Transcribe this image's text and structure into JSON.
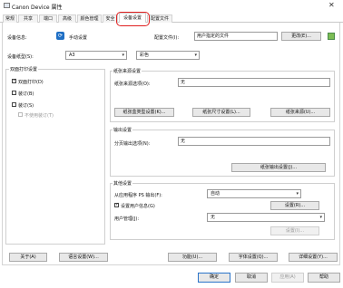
{
  "window": {
    "title": "Canon Device 属性",
    "close": "✕"
  },
  "tabs": [
    "常规",
    "共享",
    "端口",
    "高级",
    "颜色管理",
    "安全",
    "设备设置",
    "配置文件"
  ],
  "header": {
    "device_info_label": "设备信息:",
    "manual_setting": "手动设置",
    "config_file_label": "配置文件(I):",
    "config_file_value": "用户指定的文件",
    "change_btn": "更改(E)...",
    "device_size_label": "设备纸型(S):",
    "device_size_value": "A3",
    "color_label": "彩色",
    "icon_names": [
      "sync-icon",
      "config-icon"
    ]
  },
  "left_group": {
    "title": "双面打印设置",
    "items": [
      {
        "label": "双面打印(D)",
        "checked": true,
        "disabled": false
      },
      {
        "label": "装订(B)",
        "checked": false,
        "disabled": false
      },
      {
        "label": "装订(S)",
        "checked": false,
        "disabled": false
      },
      {
        "label": "不使用装订(T)",
        "checked": false,
        "disabled": true
      }
    ]
  },
  "paper_source": {
    "title": "纸张来源设置",
    "label": "纸张来源选项(O):",
    "value": "无",
    "buttons": [
      "纸张盒类型设置(K)...",
      "纸张尺寸设置(L)...",
      "纸张来源(U)..."
    ]
  },
  "output": {
    "title": "输出设置",
    "label": "分页输出选项(N):",
    "value": "无",
    "button": "纸张输出设置(J)..."
  },
  "other": {
    "title": "其他设置",
    "rows": [
      {
        "label": "从应用程序 PS 输出(F):",
        "value": "自动"
      },
      {
        "label": "设置用户信息(G)",
        "checked": true,
        "button": "设置(R)..."
      },
      {
        "label": "用户管理(J):",
        "value": "无",
        "button": "设置(I)..."
      }
    ]
  },
  "footer_buttons": [
    "关于(A)",
    "语言设置(W)...",
    "功能(U)...",
    "字体设置(Q)...",
    "详细设置(Y)..."
  ],
  "dialog_buttons": [
    "确定",
    "取消",
    "应用(A)",
    "帮助"
  ]
}
